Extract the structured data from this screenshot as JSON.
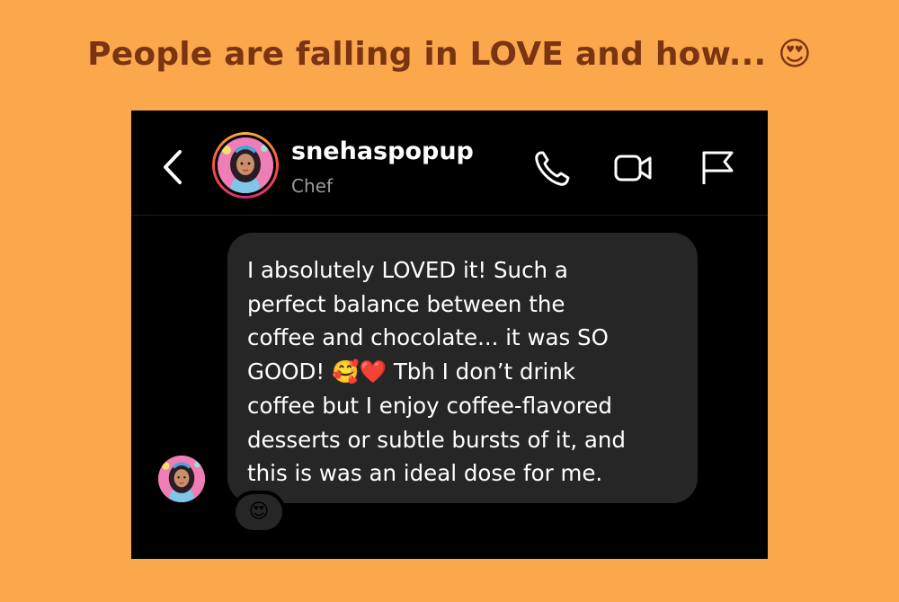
{
  "headline": "People are falling in LOVE and how... 😍",
  "header": {
    "username": "snehaspopup",
    "subtitle": "Chef",
    "icons": [
      "back-chevron-icon",
      "phone-icon",
      "video-camera-icon",
      "flag-icon"
    ]
  },
  "message": {
    "text": "I absolutely LOVED it! Such a\nperfect balance between the\ncoffee and chocolate... it was SO\nGOOD! 🥰❤️  Tbh I don’t drink\ncoffee but I enjoy coffee-flavored\ndesserts or subtle bursts of it, and\nthis is was an ideal dose for me.",
    "reaction": "😍"
  },
  "colors": {
    "background": "#fba84d",
    "headline": "#7a3412",
    "screen": "#000000",
    "bubble": "#262626"
  }
}
